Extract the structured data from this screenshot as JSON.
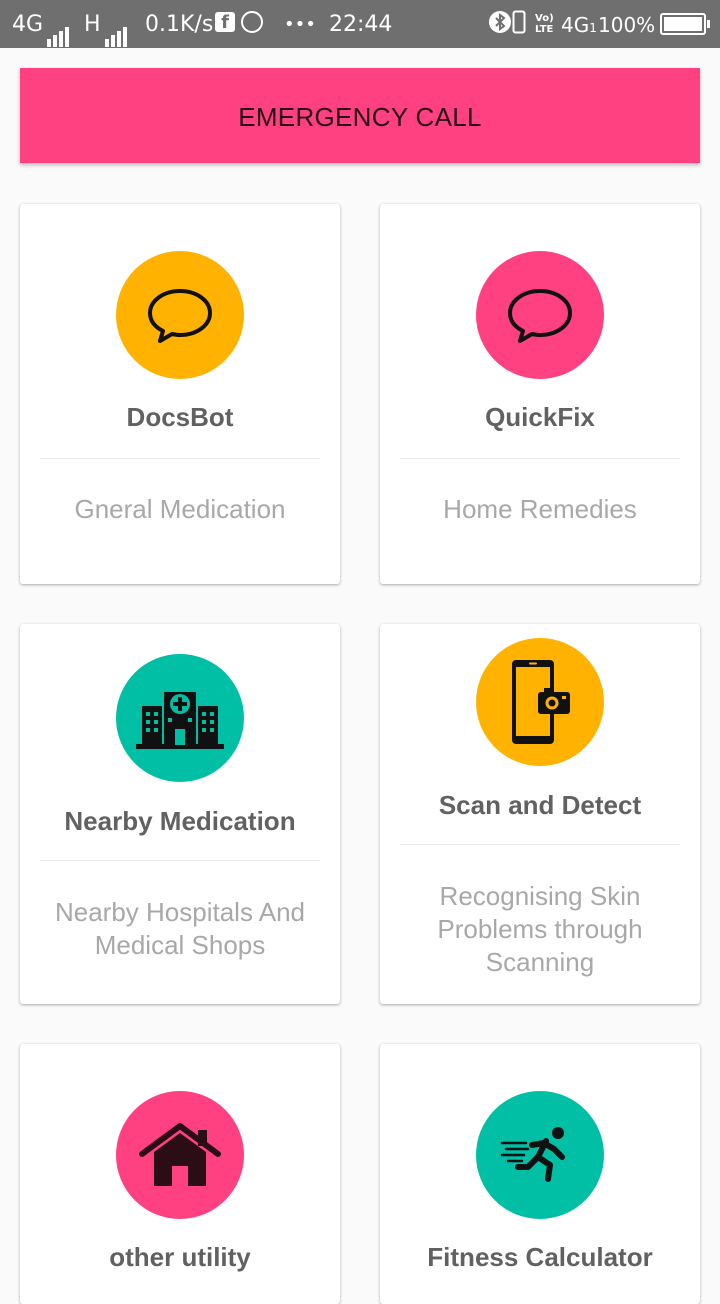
{
  "status_bar": {
    "network1": "4G",
    "network2": "H",
    "speed": "0.1K/s",
    "fb_glyph": "f",
    "more": "•••",
    "time": "22:44",
    "volte_top": "Vo)",
    "volte_bottom": "LTE",
    "network3": "4G",
    "network3_sub": "1",
    "battery": "100%"
  },
  "emergency": {
    "label": "EMERGENCY CALL",
    "color": "#ff4081"
  },
  "cards": [
    {
      "title": "DocsBot",
      "subtitle": "Gneral Medication",
      "icon": "chat-bubble-icon",
      "color": "#ffb300"
    },
    {
      "title": "QuickFix",
      "subtitle": "Home Remedies",
      "icon": "chat-bubble-icon",
      "color": "#ff4081"
    },
    {
      "title": "Nearby Medication",
      "subtitle": "Nearby Hospitals And Medical Shops",
      "icon": "hospital-icon",
      "color": "#00bfa5"
    },
    {
      "title": "Scan and Detect",
      "subtitle": "Recognising Skin Problems through Scanning",
      "icon": "phone-camera-icon",
      "color": "#ffb300"
    },
    {
      "title": "other utility",
      "subtitle": "",
      "icon": "home-icon",
      "color": "#ff4081"
    },
    {
      "title": "Fitness Calculator",
      "subtitle": "",
      "icon": "runner-icon",
      "color": "#00bfa5"
    }
  ]
}
